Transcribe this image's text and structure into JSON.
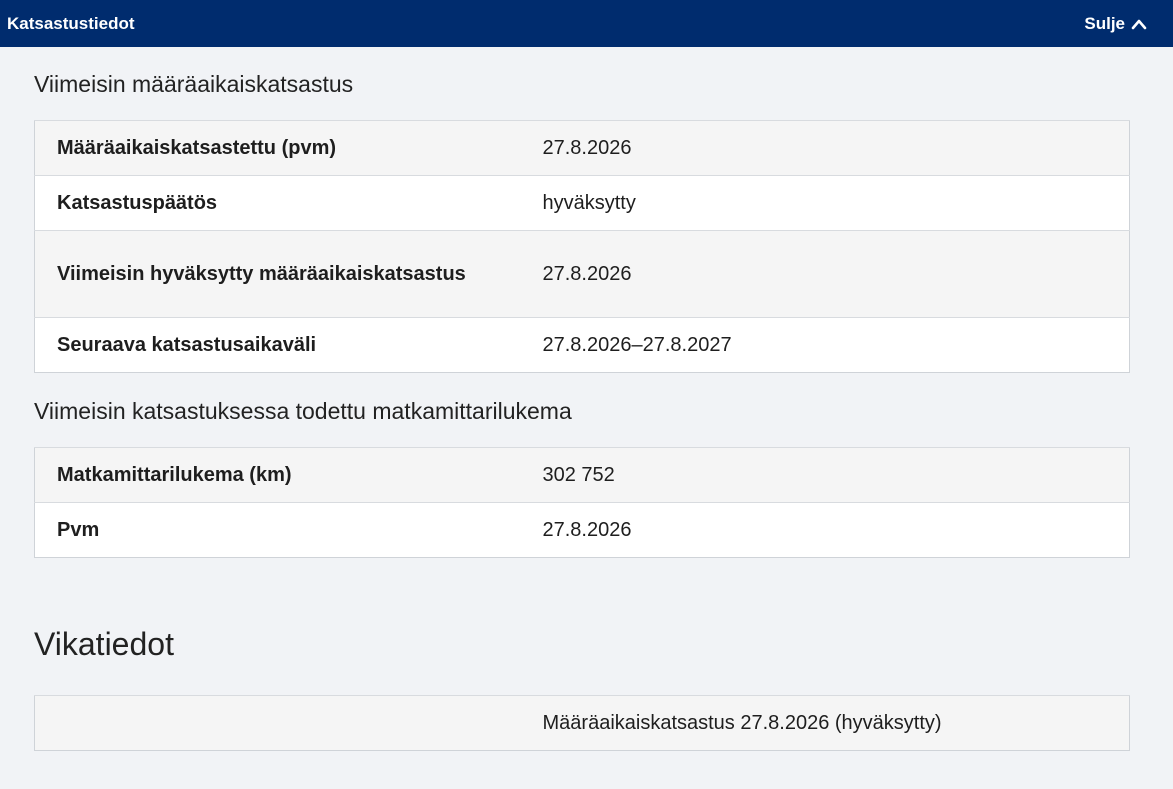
{
  "header": {
    "title": "Katsastustiedot",
    "close_label": "Sulje",
    "close_icon": "chevron-up-icon"
  },
  "inspection": {
    "heading": "Viimeisin määräaikaiskatsastus",
    "rows": [
      {
        "key": "Määräaikaiskatsastettu (pvm)",
        "value": "27.8.2026"
      },
      {
        "key": "Katsastuspäätös",
        "value": "hyväksytty"
      },
      {
        "key": "Viimeisin hyväksytty määräaikaiskatsastus",
        "value": "27.8.2026"
      },
      {
        "key": "Seuraava katsastusaikaväli",
        "value": "27.8.2026–27.8.2027"
      }
    ]
  },
  "odometer": {
    "heading": "Viimeisin katsastuksessa todettu matkamittarilukema",
    "rows": [
      {
        "key": "Matkamittarilukema (km)",
        "value": "302 752"
      },
      {
        "key": "Pvm",
        "value": "27.8.2026"
      }
    ]
  },
  "defects": {
    "heading": "Vikatiedot",
    "rows": [
      {
        "key": "",
        "value": "Määräaikaiskatsastus 27.8.2026 (hyväksytty)"
      }
    ]
  },
  "colors": {
    "header_bg": "#002c6e",
    "page_bg": "#f1f3f6"
  }
}
